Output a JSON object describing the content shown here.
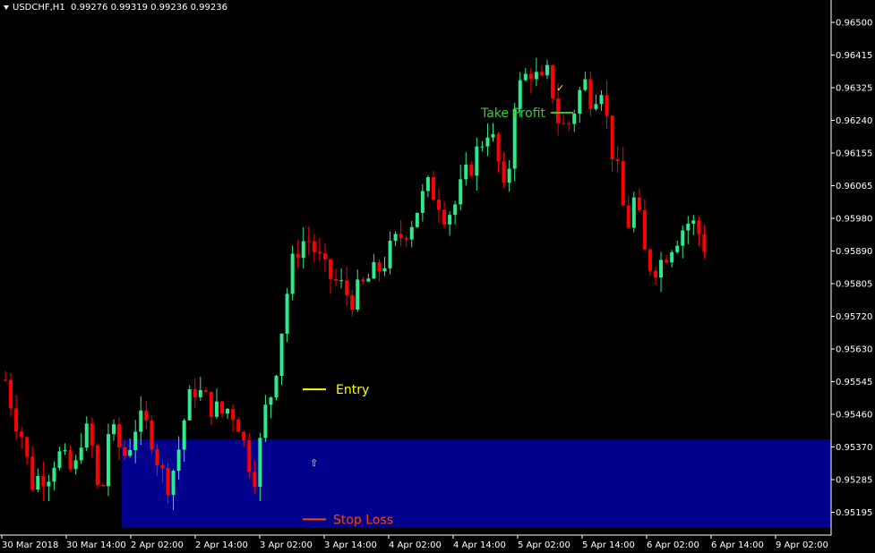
{
  "header": {
    "symbol": "USDCHF,H1",
    "ohlc": "0.99276 0.99319 0.99236 0.99236"
  },
  "colors": {
    "background": "#000000",
    "bull": "#2DEB8C",
    "bear": "#FF0000",
    "zone": "#00008C",
    "take_profit": "#3CC83C",
    "entry": "#FFFF00",
    "stop_loss": "#FF4400",
    "axis": "#FFFFFF"
  },
  "chart_data": {
    "type": "candlestick",
    "ylim": [
      0.95155,
      0.95585
    ],
    "y_ticks": [
      "0.96500",
      "0.96415",
      "0.96325",
      "0.96240",
      "0.96155",
      "0.96065",
      "0.95980",
      "0.95890",
      "0.95805",
      "0.95720",
      "0.95630",
      "0.95545",
      "0.95460",
      "0.95370",
      "0.95285",
      "0.95195"
    ],
    "x_ticks": [
      "30 Mar 2018",
      "30 Mar 14:00",
      "2 Apr 02:00",
      "2 Apr 14:00",
      "3 Apr 02:00",
      "3 Apr 14:00",
      "4 Apr 02:00",
      "4 Apr 14:00",
      "5 Apr 02:00",
      "5 Apr 14:00",
      "6 Apr 02:00",
      "6 Apr 14:00",
      "9 Apr 02:00"
    ],
    "close_trend": [
      0.9557,
      0.9548,
      0.9542,
      0.953,
      0.9532,
      0.9533,
      0.9538,
      0.9535,
      0.9532,
      0.9545,
      0.954,
      0.9523,
      0.9545,
      0.954,
      0.9537,
      0.9545,
      0.9546,
      0.9542,
      0.9533,
      0.953,
      0.9538,
      0.955,
      0.9555,
      0.9552,
      0.955,
      0.9548,
      0.955,
      0.9546,
      0.9537,
      0.9532,
      0.9548,
      0.9555,
      0.957,
      0.9585,
      0.9592,
      0.9594,
      0.959,
      0.9585,
      0.9583,
      0.9581,
      0.9578,
      0.958,
      0.9583,
      0.9585,
      0.9588,
      0.9592,
      0.9595,
      0.9598,
      0.9603,
      0.9607,
      0.9605,
      0.96,
      0.9602,
      0.9608,
      0.9613,
      0.9618,
      0.9623,
      0.9615,
      0.9602,
      0.963,
      0.9635,
      0.9638,
      0.9633,
      0.9637,
      0.9625,
      0.9622,
      0.9628,
      0.9635,
      0.963,
      0.9635,
      0.962,
      0.961,
      0.9596,
      0.9605,
      0.959,
      0.9586,
      0.9588,
      0.9592,
      0.9595,
      0.9598,
      0.9597,
      0.9592
    ],
    "annotations": {
      "take_profit": {
        "label": "Take Profit",
        "price": 0.96265
      },
      "entry": {
        "label": "Entry",
        "price": 0.95545
      },
      "stop_loss": {
        "label": "Stop Loss",
        "price": 0.95195
      }
    },
    "zone": {
      "from": 0.95185,
      "to": 0.95415
    },
    "marker_check": "✓",
    "marker_arrow": "⇧"
  }
}
